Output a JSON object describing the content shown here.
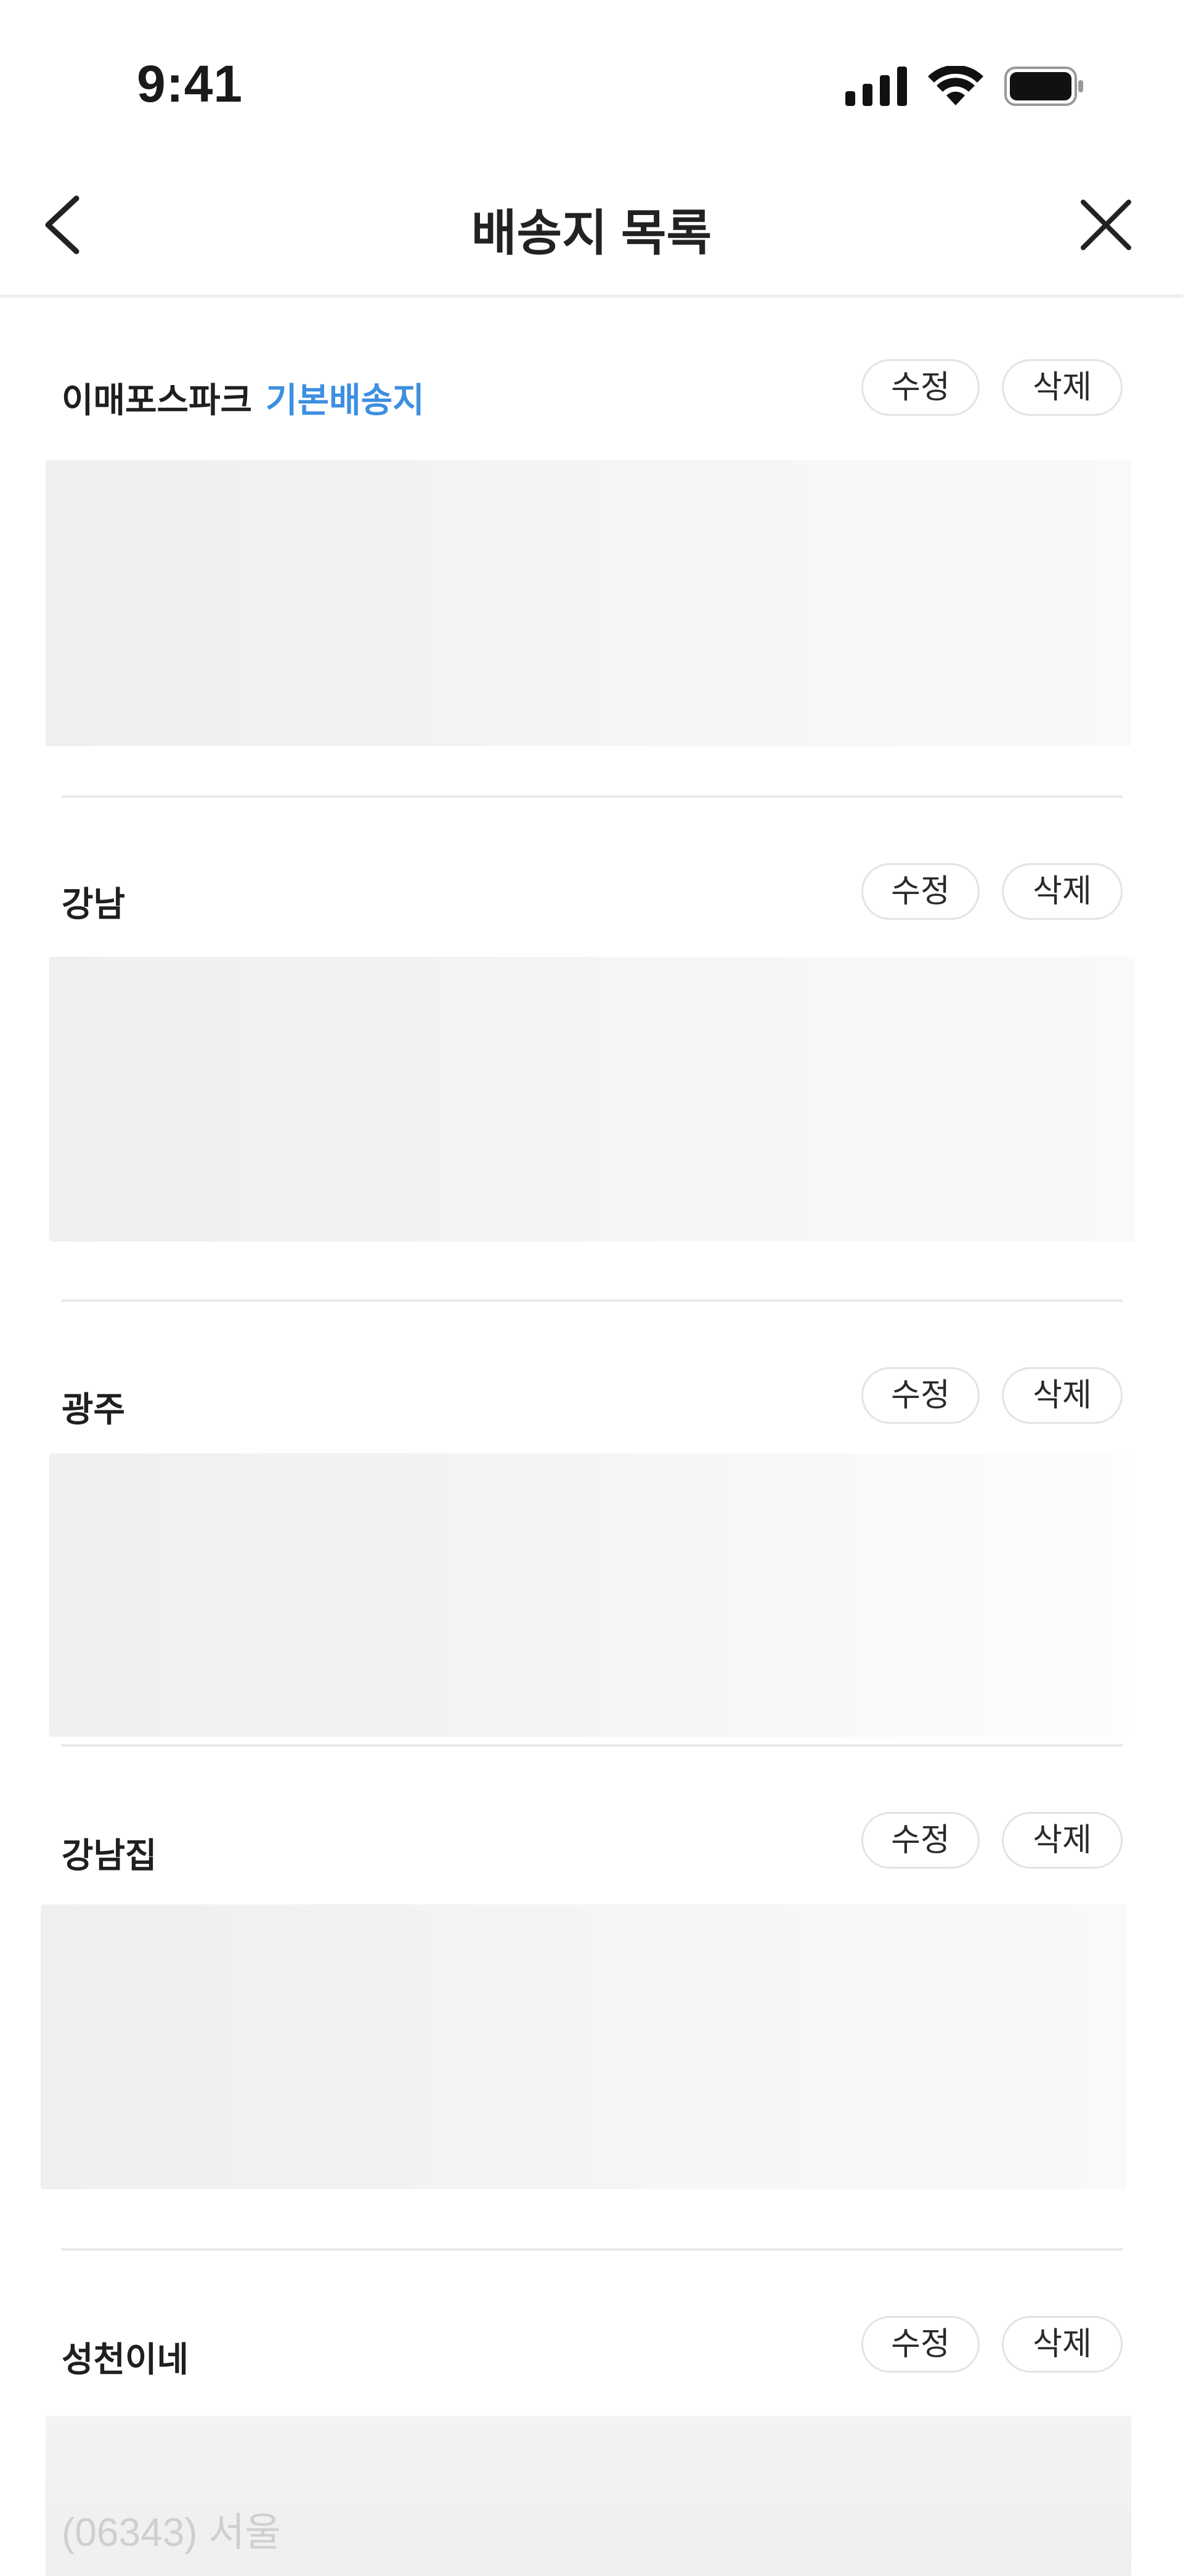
{
  "status_bar": {
    "time": "9:41"
  },
  "nav": {
    "title": "배송지 목록"
  },
  "addresses": [
    {
      "name": "이매포스파크",
      "badge": "기본배송지",
      "edit": "수정",
      "delete": "삭제"
    },
    {
      "name": "강남",
      "edit": "수정",
      "delete": "삭제"
    },
    {
      "name": "광주",
      "edit": "수정",
      "delete": "삭제"
    },
    {
      "name": "강남집",
      "edit": "수정",
      "delete": "삭제"
    },
    {
      "name": "성천이네",
      "edit": "수정",
      "delete": "삭제",
      "partial_text": "(06343) 서울"
    }
  ],
  "colors": {
    "accent": "#3d8fe0",
    "divider": "#eaeaea"
  }
}
